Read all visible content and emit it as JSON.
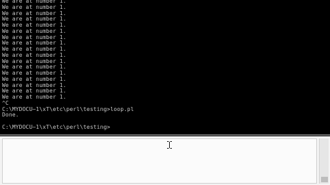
{
  "console": {
    "lines": [
      "We are at number 1.",
      "We are at number 1.",
      "We are at number 1.",
      "We are at number 1.",
      "We are at number 1.",
      "We are at number 1.",
      "We are at number 1.",
      "We are at number 1.",
      "We are at number 1.",
      "We are at number 1.",
      "We are at number 1.",
      "We are at number 1.",
      "We are at number 1.",
      "We are at number 1.",
      "We are at number 1.",
      "We are at number 1.",
      "We are at number 1.",
      "^C",
      "C:\\MYDOCU~1\\xT\\etc\\perl\\testing>loop.pl",
      "Done.",
      "",
      "C:\\MYDOCU~1\\xT\\etc\\perl\\testing>"
    ]
  },
  "editor": {
    "cursor_icon": "text-cursor-icon"
  },
  "colors": {
    "console_bg": "#000000",
    "console_text": "#c7c7c7",
    "pane_bg": "#f3f3f3"
  }
}
